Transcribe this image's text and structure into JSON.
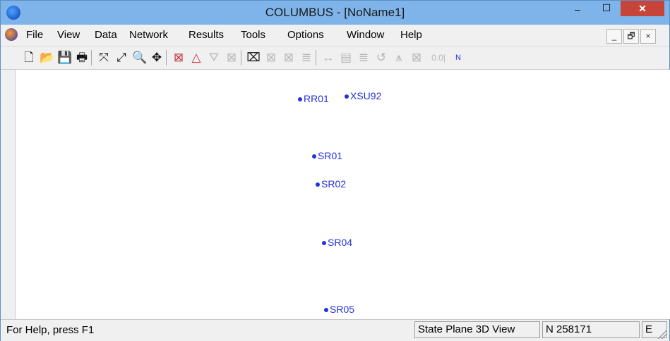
{
  "window": {
    "title": "COLUMBUS - [NoName1]"
  },
  "titlebar_buttons": {
    "minimize": "–",
    "maximize": "☐",
    "close": "✕"
  },
  "menu": {
    "items": [
      "File",
      "View",
      "Data",
      "Network",
      "Results",
      "Tools",
      "Options",
      "Window",
      "Help"
    ],
    "mdi": {
      "minimize": "_",
      "restore": "🗗",
      "close": "×"
    }
  },
  "toolbar": {
    "tools": [
      {
        "icon": "new-file-icon",
        "glyph": "🗋"
      },
      {
        "icon": "open-folder-icon",
        "glyph": "📂"
      },
      {
        "icon": "save-icon",
        "glyph": "💾"
      },
      {
        "icon": "print-icon",
        "glyph": "🖶"
      },
      {
        "icon": "zoom-extents-icon",
        "glyph": "⤧"
      },
      {
        "icon": "zoom-in-icon",
        "glyph": "⤢"
      },
      {
        "icon": "zoom-window-icon",
        "glyph": "🔍"
      },
      {
        "icon": "pan-icon",
        "glyph": "✥"
      },
      {
        "icon": "traverse-icon",
        "glyph": "⊠"
      },
      {
        "icon": "triangle-icon",
        "glyph": "△"
      },
      {
        "icon": "dotted-triangle-icon",
        "glyph": "⛛"
      },
      {
        "icon": "box-x-icon",
        "glyph": "⊠"
      },
      {
        "icon": "network-adjust-icon",
        "glyph": "⌧"
      },
      {
        "icon": "box-x-2-icon",
        "glyph": "⊠"
      },
      {
        "icon": "box-x-3-icon",
        "glyph": "⊠"
      },
      {
        "icon": "stack-icon",
        "glyph": "≣"
      },
      {
        "icon": "arrows-icon",
        "glyph": "↔"
      },
      {
        "icon": "list-icon",
        "glyph": "▤"
      },
      {
        "icon": "stack-2-icon",
        "glyph": "≣"
      },
      {
        "icon": "cycle-icon",
        "glyph": "↺"
      },
      {
        "icon": "tripod-icon",
        "glyph": "⩚"
      },
      {
        "icon": "box-x-4-icon",
        "glyph": "⊠"
      }
    ],
    "tail_text": "0.0|",
    "tail_text2": "N"
  },
  "points": [
    {
      "label": "RR01"
    },
    {
      "label": "XSU92"
    },
    {
      "label": "SR01"
    },
    {
      "label": "SR02"
    },
    {
      "label": "SR04"
    },
    {
      "label": "SR05"
    }
  ],
  "status": {
    "help": "For Help, press F1",
    "view": "State Plane 3D View",
    "north": "N 258171",
    "east": "E"
  }
}
